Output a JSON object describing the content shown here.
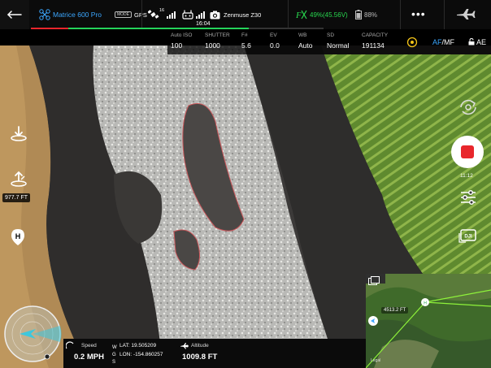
{
  "top_bar": {
    "aircraft_name": "Matrice 600 Pro",
    "flight_mode": "MODE",
    "gps_label": "GPS",
    "satellite_count": "16",
    "camera_name": "Zenmuse Z30",
    "aircraft_battery": "49%(45.56V)",
    "remote_battery": "88%",
    "flight_time": "16:04"
  },
  "camera_params": {
    "iso": {
      "label": "Auto ISO",
      "value": "100"
    },
    "shutter": {
      "label": "SHUTTER",
      "value": "1000"
    },
    "fnum": {
      "label": "F#",
      "value": "5.6"
    },
    "ev": {
      "label": "EV",
      "value": "0.0"
    },
    "wb": {
      "label": "WB",
      "value": "Auto"
    },
    "sd": {
      "label": "SD",
      "value": "Normal"
    },
    "capacity": {
      "label": "CAPACITY",
      "value": "191134"
    },
    "focus_mode_af": "AF",
    "focus_mode_mf": "/MF",
    "ae_lock": "AE"
  },
  "left_panel": {
    "altitude_tag": "977.7 FT"
  },
  "right_panel": {
    "record_time": "11:12"
  },
  "telemetry": {
    "speed_label": "Speed",
    "speed_value": "0.2 MPH",
    "lat": "LAT: 19.505209",
    "lon": "LON: -154.860257",
    "altitude_label": "Altitude",
    "altitude_value": "1009.8 FT"
  },
  "minimap": {
    "distance": "4513.2 FT",
    "legal": "Legal"
  },
  "colors": {
    "accent_blue": "#3ca7ff",
    "battery_green": "#28d84f",
    "record_red": "#e8262c",
    "flight_path_green": "#8ef23a"
  }
}
